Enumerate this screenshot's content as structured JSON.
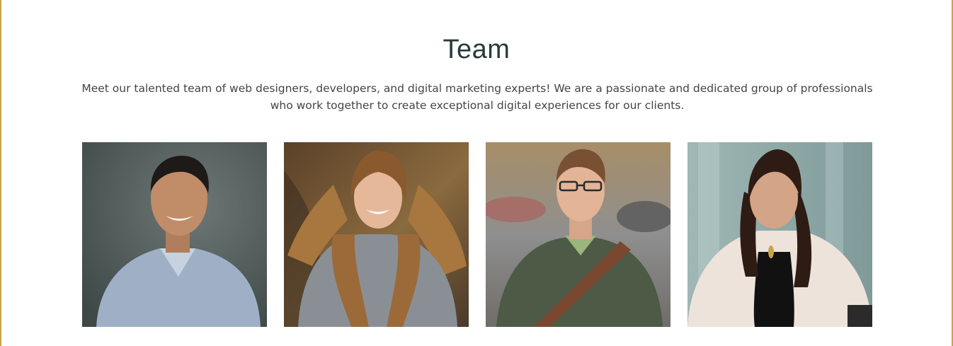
{
  "section": {
    "title": "Team",
    "description": "Meet our talented team of web designers, developers, and digital marketing experts! We are a passionate and dedicated group of professionals who work together to create exceptional digital experiences for our clients."
  },
  "members": [
    {
      "photo": "team-member-photo-1"
    },
    {
      "photo": "team-member-photo-2"
    },
    {
      "photo": "team-member-photo-3"
    },
    {
      "photo": "team-member-photo-4"
    }
  ],
  "colors": {
    "title": "#2a3a3a",
    "text": "#444444",
    "frame_border": "#c9a24a"
  }
}
